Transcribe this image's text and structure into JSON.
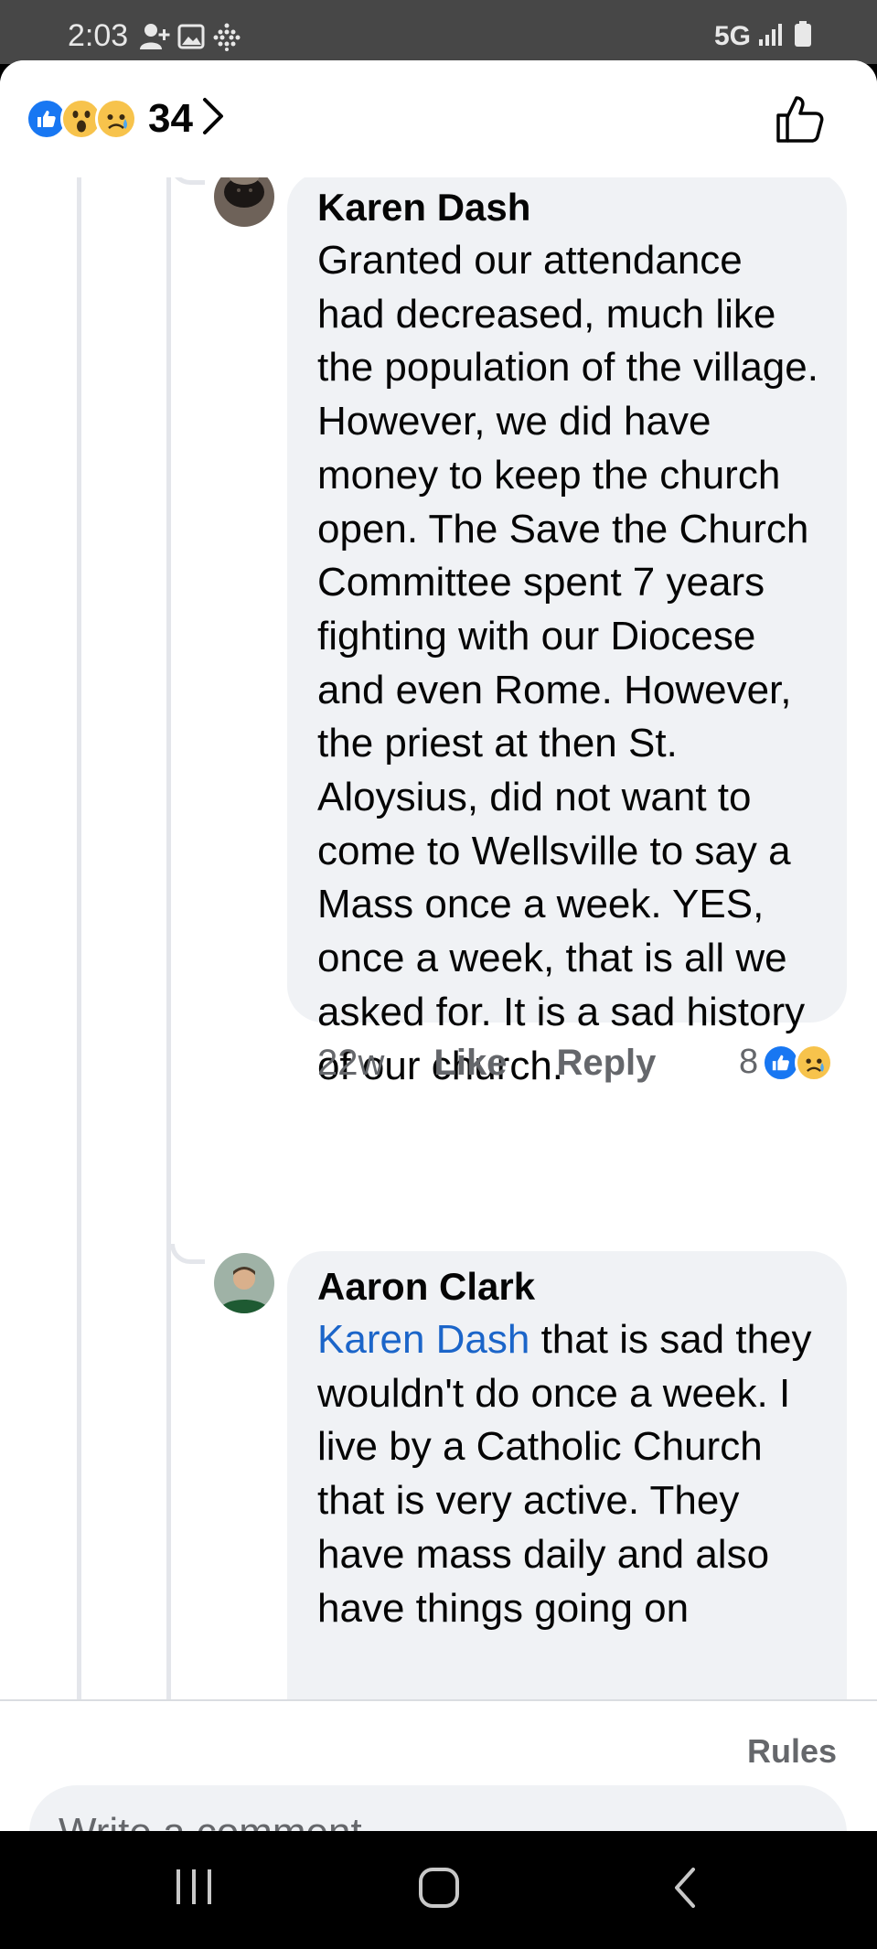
{
  "status_bar": {
    "time": "2:03",
    "network": "5G",
    "left_icons": [
      "add-person-icon",
      "image-icon",
      "dots-grid-icon"
    ],
    "right_icons": [
      "signal-icon",
      "battery-icon"
    ]
  },
  "header": {
    "reactions": [
      "like",
      "wow",
      "sad"
    ],
    "reaction_count": "34"
  },
  "comments": [
    {
      "author": "Karen Dash",
      "text": "Granted our attendance had decreased, much like the population of the village. However, we did have money to keep the church open. The Save the Church Committee spent 7 years fighting with our Diocese and even Rome. However, the priest at then St. Aloysius, did not want to come to Wellsville to say a Mass once a week. YES, once a week, that is all we asked for. It is a sad history of our church.",
      "time": "22w",
      "like_label": "Like",
      "reply_label": "Reply",
      "reaction_count": "8",
      "reactions": [
        "like",
        "sad"
      ]
    },
    {
      "author": "Aaron Clark",
      "mention": "Karen Dash",
      "text": " that is sad they wouldn't do once a week. I live by a Catholic Church that is very active. They have mass daily and also have things going on"
    }
  ],
  "composer": {
    "rules_label": "Rules",
    "placeholder": "Write a comment…"
  },
  "colors": {
    "accent": "#1877f2",
    "mention": "#1b65c9",
    "bubble": "#f0f2f5",
    "muted_text": "#65676b"
  }
}
